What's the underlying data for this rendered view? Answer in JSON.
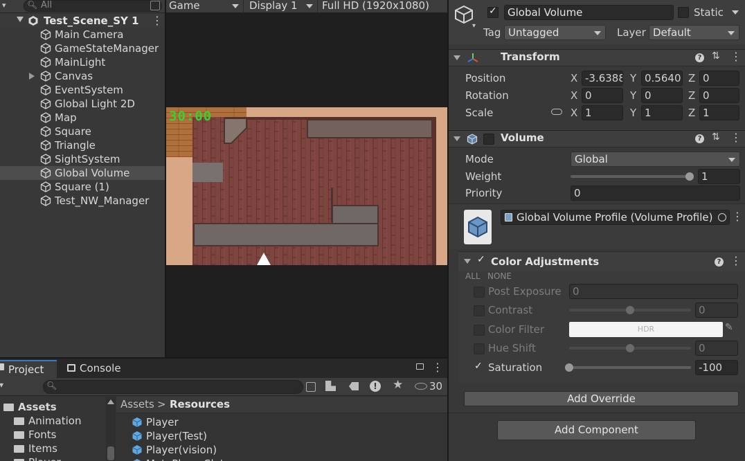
{
  "hierarchy": {
    "search_placeholder": "All",
    "scene_name": "Test_Scene_SY 1",
    "items": [
      {
        "label": "Main Camera",
        "has_children": false,
        "selected": false
      },
      {
        "label": "GameStateManager",
        "has_children": false,
        "selected": false
      },
      {
        "label": "MainLight",
        "has_children": false,
        "selected": false
      },
      {
        "label": "Canvas",
        "has_children": true,
        "selected": false
      },
      {
        "label": "EventSystem",
        "has_children": false,
        "selected": false
      },
      {
        "label": "Global Light 2D",
        "has_children": false,
        "selected": false
      },
      {
        "label": "Map",
        "has_children": false,
        "selected": false
      },
      {
        "label": "Square",
        "has_children": false,
        "selected": false
      },
      {
        "label": "Triangle",
        "has_children": false,
        "selected": false
      },
      {
        "label": "SightSystem",
        "has_children": false,
        "selected": false
      },
      {
        "label": "Global Volume",
        "has_children": false,
        "selected": true
      },
      {
        "label": "Square (1)",
        "has_children": false,
        "selected": false
      },
      {
        "label": "Test_NW_Manager",
        "has_children": false,
        "selected": false
      }
    ]
  },
  "game": {
    "view_dropdown": "Game",
    "display_dropdown": "Display 1",
    "resolution_dropdown": "Full HD (1920x1080)",
    "timer_text": "30:00",
    "timer_color": "#39d22c"
  },
  "project": {
    "tab_project": "Project",
    "tab_console": "Console",
    "visible_count": "30",
    "tree": [
      {
        "label": "Assets",
        "bold": true,
        "depth": 0
      },
      {
        "label": "Animation",
        "bold": false,
        "depth": 1
      },
      {
        "label": "Fonts",
        "bold": false,
        "depth": 1
      },
      {
        "label": "Items",
        "bold": false,
        "depth": 1
      },
      {
        "label": "Player",
        "bold": false,
        "depth": 1
      }
    ],
    "breadcrumb_root": "Assets",
    "breadcrumb_current": "Resources",
    "files": [
      "Player",
      "Player(Test)",
      "Player(vision)",
      "MetaPlayerSlot"
    ]
  },
  "inspector": {
    "object_name": "Global Volume",
    "active": true,
    "static_label": "Static",
    "tag_label": "Tag",
    "tag_value": "Untagged",
    "layer_label": "Layer",
    "layer_value": "Default",
    "transform": {
      "title": "Transform",
      "position_label": "Position",
      "rotation_label": "Rotation",
      "scale_label": "Scale",
      "position": {
        "x": "-3.6388",
        "y": "0.5640",
        "z": "0"
      },
      "rotation": {
        "x": "0",
        "y": "0",
        "z": "0"
      },
      "scale": {
        "x": "1",
        "y": "1",
        "z": "1"
      },
      "axis_x": "X",
      "axis_y": "Y",
      "axis_z": "Z"
    },
    "volume": {
      "title": "Volume",
      "mode_label": "Mode",
      "mode_value": "Global",
      "weight_label": "Weight",
      "weight_value": "1",
      "weight_fraction": 1.0,
      "priority_label": "Priority",
      "priority_value": "0",
      "profile_value": "Global Volume Profile (Volume Profile)"
    },
    "color_adjustments": {
      "title": "Color Adjustments",
      "all_label": "ALL",
      "none_label": "NONE",
      "post_exposure_label": "Post Exposure",
      "post_exposure_value": "0",
      "contrast_label": "Contrast",
      "contrast_value": "0",
      "contrast_fraction": 0.5,
      "color_filter_label": "Color Filter",
      "color_filter_hdr": "HDR",
      "hue_shift_label": "Hue Shift",
      "hue_shift_value": "0",
      "hue_shift_fraction": 0.5,
      "saturation_label": "Saturation",
      "saturation_value": "-100",
      "saturation_fraction": 0.0
    },
    "add_override": "Add Override",
    "add_component": "Add Component"
  }
}
